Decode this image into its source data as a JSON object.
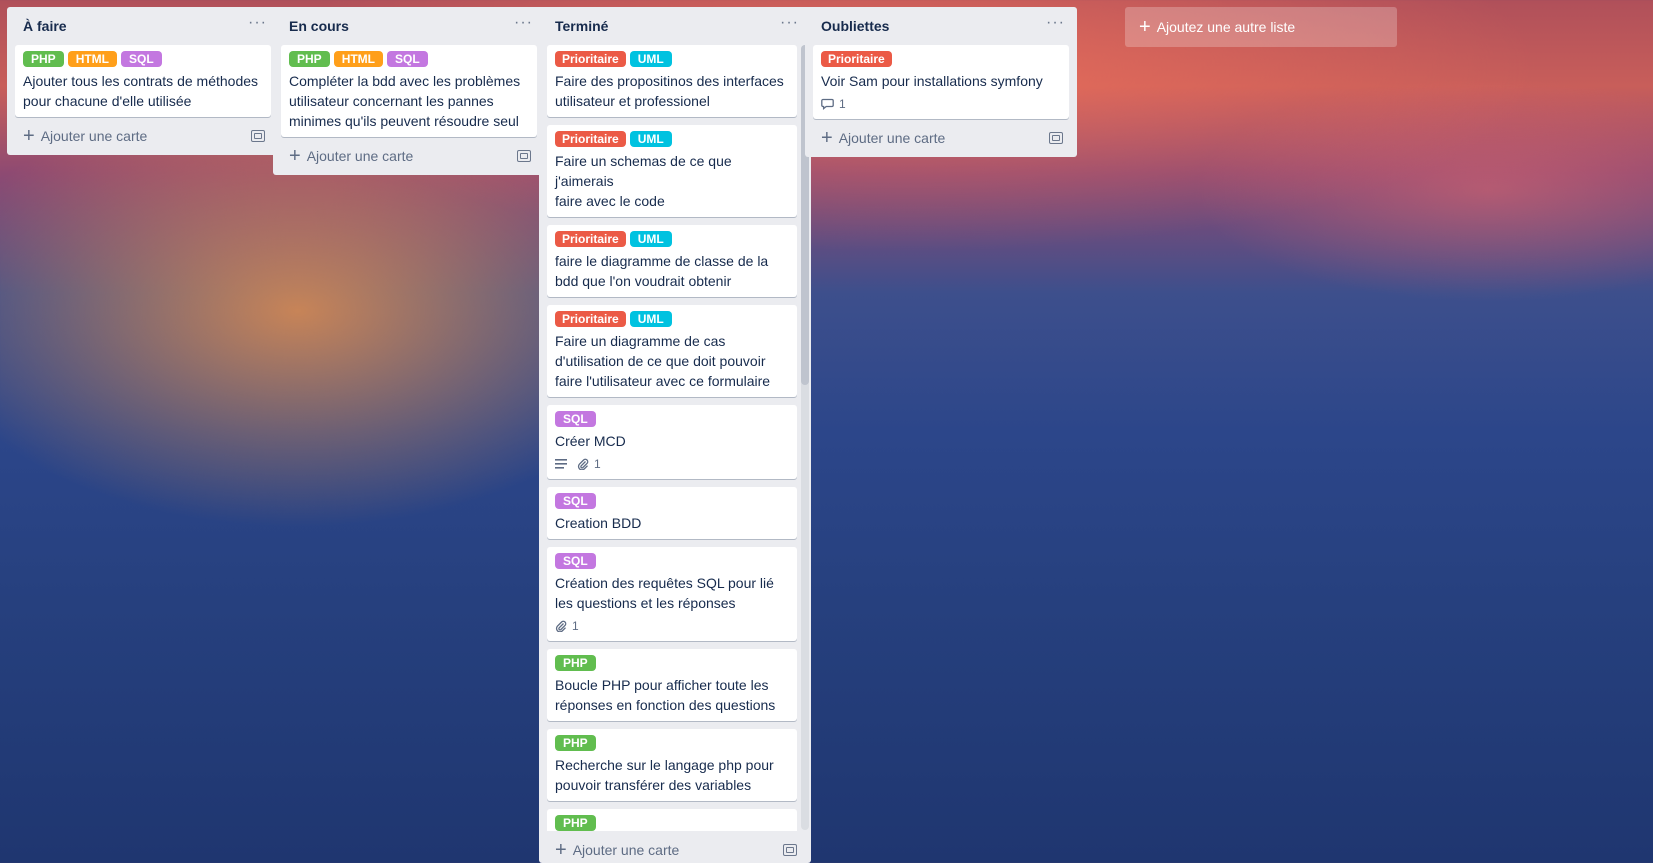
{
  "colors": {
    "PHP": "#61bd4f",
    "HTML": "#ff9f1a",
    "SQL": "#c377e0",
    "Prioritaire": "#eb5a46",
    "UML": "#00c2e0"
  },
  "lists": [
    {
      "title": "À faire",
      "menu": "···",
      "add_card": "Ajouter une carte",
      "cards": [
        {
          "labels": [
            "PHP",
            "HTML",
            "SQL"
          ],
          "title": "Ajouter tous les contrats de méthodes\npour chacune d'elle utilisée"
        }
      ]
    },
    {
      "title": "En cours",
      "menu": "···",
      "add_card": "Ajouter une carte",
      "cards": [
        {
          "labels": [
            "PHP",
            "HTML",
            "SQL"
          ],
          "title": "Compléter la bdd avec les problèmes\nutilisateur concernant les pannes\nminimes qu'ils peuvent résoudre seul"
        }
      ]
    },
    {
      "title": "Terminé",
      "menu": "···",
      "add_card": "Ajouter une carte",
      "cards": [
        {
          "labels": [
            "Prioritaire",
            "UML"
          ],
          "title": "Faire des propositinos des interfaces\nutilisateur et professionel"
        },
        {
          "labels": [
            "Prioritaire",
            "UML"
          ],
          "title": "Faire un schemas de ce que j'aimerais\nfaire avec le code"
        },
        {
          "labels": [
            "Prioritaire",
            "UML"
          ],
          "title": "faire le diagramme de classe de la\nbdd que l'on voudrait obtenir"
        },
        {
          "labels": [
            "Prioritaire",
            "UML"
          ],
          "title": "Faire un diagramme de cas\nd'utilisation de ce que doit pouvoir\nfaire l'utilisateur avec ce formulaire"
        },
        {
          "labels": [
            "SQL"
          ],
          "title": "Créer MCD",
          "badges": {
            "description": true,
            "attachments": "1"
          }
        },
        {
          "labels": [
            "SQL"
          ],
          "title": "Creation BDD"
        },
        {
          "labels": [
            "SQL"
          ],
          "title": "Création des requêtes SQL pour lié\nles questions et les réponses",
          "badges": {
            "attachments": "1"
          }
        },
        {
          "labels": [
            "PHP"
          ],
          "title": "Boucle PHP pour afficher toute les\nréponses en fonction des questions"
        },
        {
          "labels": [
            "PHP"
          ],
          "title": "Recherche sur le langage php pour\npouvoir transférer des variables"
        },
        {
          "labels": [
            "PHP"
          ],
          "title": ""
        }
      ]
    },
    {
      "title": "Oubliettes",
      "menu": "···",
      "add_card": "Ajouter une carte",
      "cards": [
        {
          "labels": [
            "Prioritaire"
          ],
          "title": "Voir Sam pour installations symfony",
          "badges": {
            "comments": "1"
          }
        }
      ]
    }
  ],
  "add_list": "Ajoutez une autre liste"
}
